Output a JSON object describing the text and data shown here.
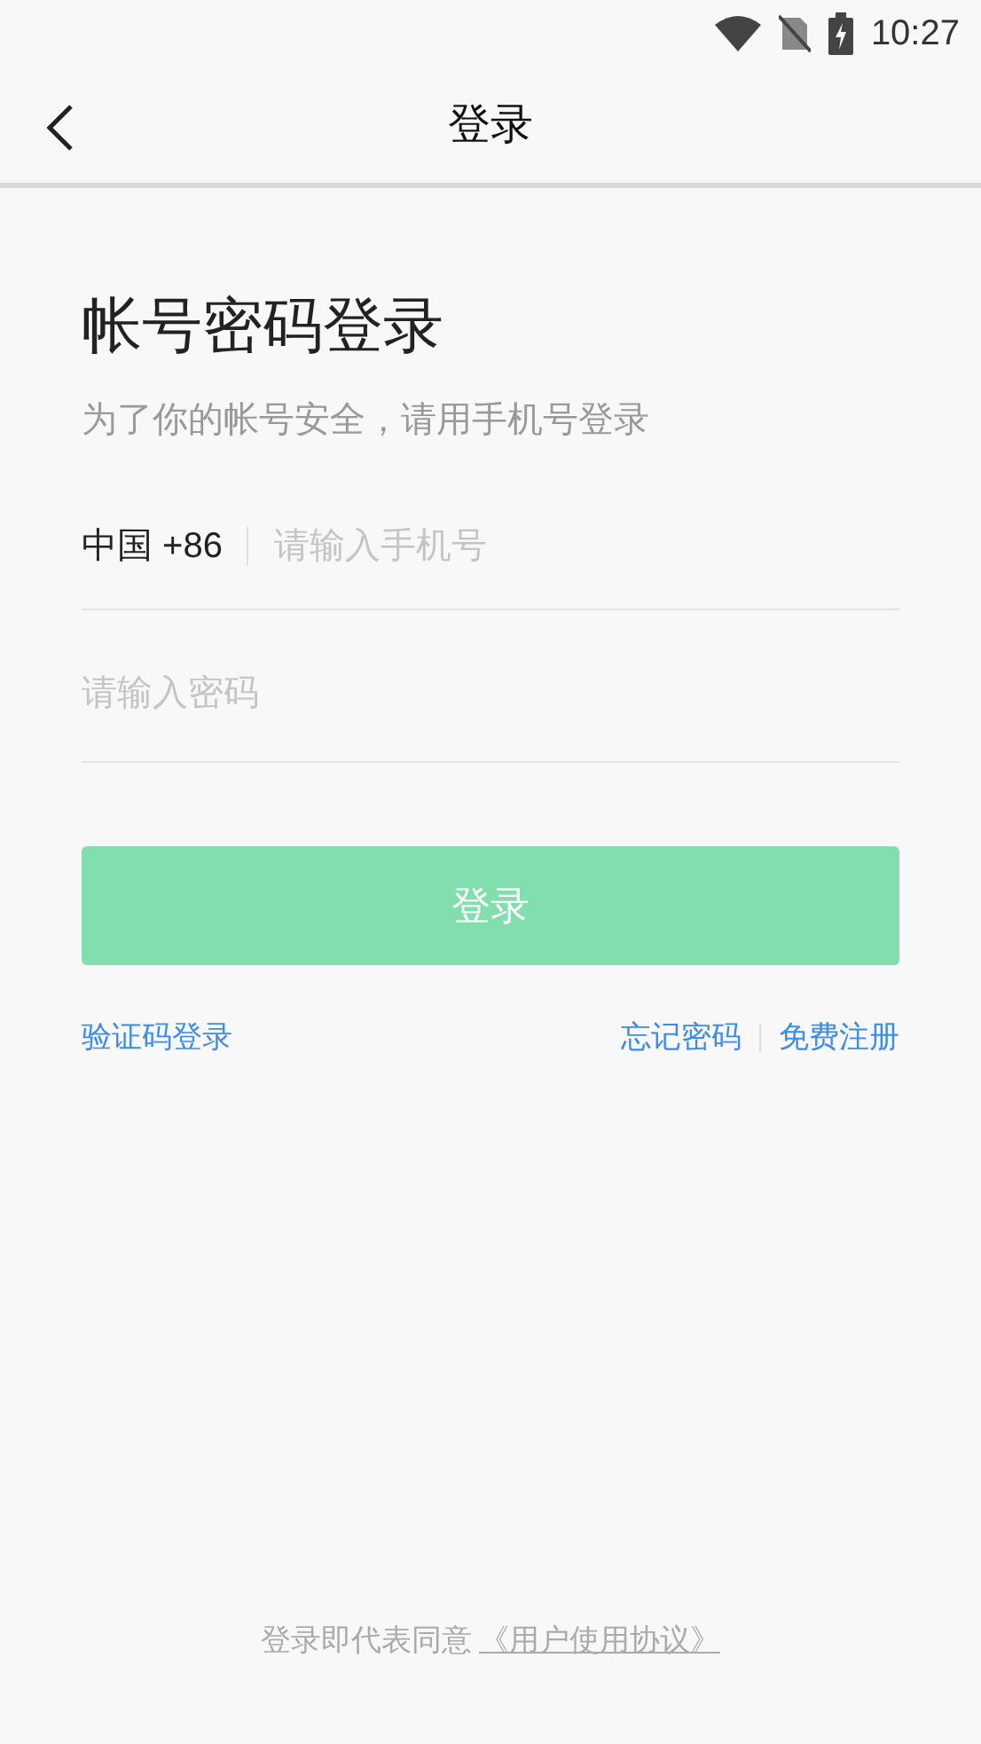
{
  "status_bar": {
    "time": "10:27"
  },
  "header": {
    "title": "登录"
  },
  "heading": "帐号密码登录",
  "subtitle": "为了你的帐号安全，请用手机号登录",
  "phone_field": {
    "country": "中国 +86",
    "placeholder": "请输入手机号"
  },
  "password_field": {
    "placeholder": "请输入密码"
  },
  "login_button": {
    "label": "登录",
    "disabled": true
  },
  "links_left": "验证码登录",
  "links_right": [
    "忘记密码",
    "免费注册"
  ],
  "footer": {
    "text": "登录即代表同意",
    "link": "《用户使用协议》"
  }
}
